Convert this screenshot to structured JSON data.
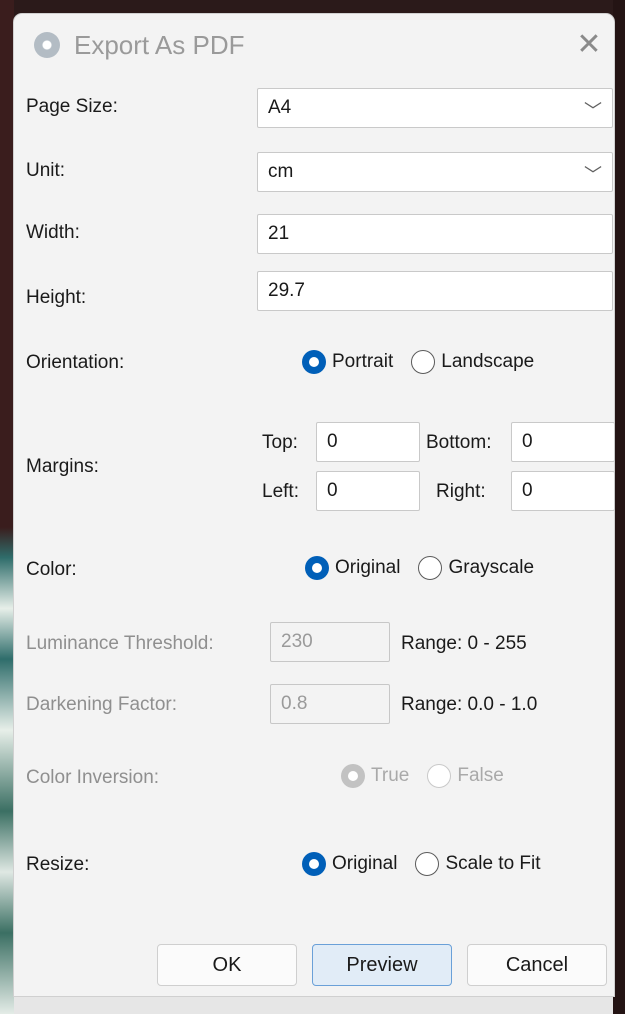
{
  "dialog": {
    "title": "Export As PDF",
    "close_glyph": "✕"
  },
  "page_size": {
    "label": "Page Size:",
    "value": "A4"
  },
  "unit": {
    "label": "Unit:",
    "value": "cm"
  },
  "width": {
    "label": "Width:",
    "value": "21"
  },
  "height": {
    "label": "Height:",
    "value": "29.7"
  },
  "orientation": {
    "label": "Orientation:",
    "options": [
      "Portrait",
      "Landscape"
    ],
    "selected": "Portrait"
  },
  "margins": {
    "label": "Margins:",
    "top_label": "Top:",
    "top_value": "0",
    "bottom_label": "Bottom:",
    "bottom_value": "0",
    "left_label": "Left:",
    "left_value": "0",
    "right_label": "Right:",
    "right_value": "0"
  },
  "color": {
    "label": "Color:",
    "options": [
      "Original",
      "Grayscale"
    ],
    "selected": "Original"
  },
  "luminance": {
    "label": "Luminance Threshold:",
    "value": "230",
    "range": "Range: 0 - 255"
  },
  "darkening": {
    "label": "Darkening Factor:",
    "value": "0.8",
    "range": "Range: 0.0 - 1.0"
  },
  "inversion": {
    "label": "Color Inversion:",
    "options": [
      "True",
      "False"
    ],
    "selected": "True"
  },
  "resize": {
    "label": "Resize:",
    "options": [
      "Original",
      "Scale to Fit"
    ],
    "selected": "Original"
  },
  "buttons": {
    "ok": "OK",
    "preview": "Preview",
    "cancel": "Cancel"
  },
  "colors": {
    "accent": "#005fb8",
    "disabled_text": "#8f8f8f"
  }
}
